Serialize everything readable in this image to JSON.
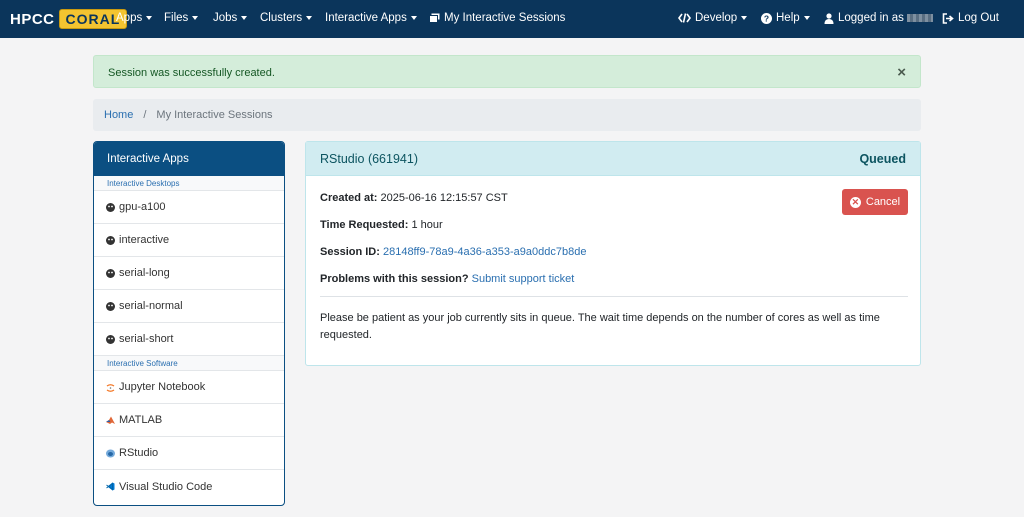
{
  "navbar": {
    "brand_left": "HPCC",
    "brand_right": "CORAL",
    "items": [
      {
        "label": "Apps"
      },
      {
        "label": "Files"
      },
      {
        "label": "Jobs"
      },
      {
        "label": "Clusters"
      },
      {
        "label": "Interactive Apps"
      },
      {
        "label": "My Interactive Sessions"
      }
    ],
    "develop": "Develop",
    "help": "Help",
    "logged_in": "Logged in as",
    "logout": "Log Out"
  },
  "alert": {
    "message": "Session was successfully created.",
    "close": "×"
  },
  "breadcrumb": {
    "home": "Home",
    "separator": "/",
    "current": "My Interactive Sessions"
  },
  "sidebar": {
    "title": "Interactive Apps",
    "desktops_label": "Interactive Desktops",
    "desktops": [
      {
        "label": "gpu-a100"
      },
      {
        "label": "interactive"
      },
      {
        "label": "serial-long"
      },
      {
        "label": "serial-normal"
      },
      {
        "label": "serial-short"
      }
    ],
    "software_label": "Interactive Software",
    "software": [
      {
        "label": "Jupyter Notebook",
        "icon": "jupyter-icon"
      },
      {
        "label": "MATLAB",
        "icon": "matlab-icon"
      },
      {
        "label": "RStudio",
        "icon": "rstudio-icon"
      },
      {
        "label": "Visual Studio Code",
        "icon": "vscode-icon"
      }
    ]
  },
  "session": {
    "title": "RStudio (661941)",
    "status": "Queued",
    "created_label": "Created at:",
    "created_value": "2025-06-16 12:15:57 CST",
    "time_label": "Time Requested:",
    "time_value": "1 hour",
    "id_label": "Session ID:",
    "id_value": "28148ff9-78a9-4a36-a353-a9a0ddc7b8de",
    "problems_label": "Problems with this session?",
    "problems_link": "Submit support ticket",
    "cancel_label": "Cancel",
    "note": "Please be patient as your job currently sits in queue. The wait time depends on the number of cores as well as time requested."
  },
  "colors": {
    "navbar": "#0b355b",
    "accent": "#0b4f82",
    "success_bg": "#d4edda",
    "info_bg": "#d1ecf1",
    "danger": "#d9534f"
  }
}
